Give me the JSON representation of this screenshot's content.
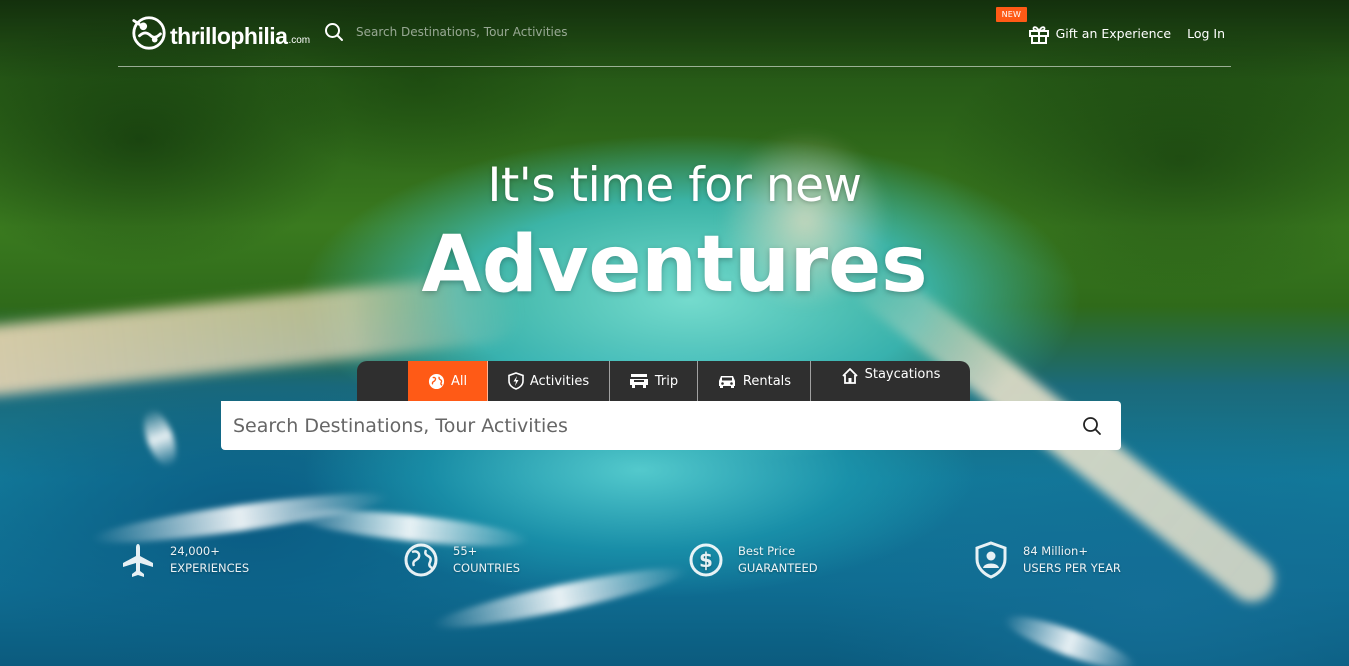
{
  "header": {
    "brand": "thrillophilia",
    "brand_suffix": ".com",
    "search_placeholder": "Search Destinations, Tour Activities",
    "new_badge": "NEW",
    "gift_label": "Gift an Experience",
    "login_label": "Log In"
  },
  "hero": {
    "line1": "It's time for new",
    "line2": "Adventures"
  },
  "tabs": [
    {
      "label": "All",
      "icon": "globe-icon",
      "active": true
    },
    {
      "label": "Activities",
      "icon": "bolt-shield-icon",
      "active": false
    },
    {
      "label": "Trip",
      "icon": "car-front-icon",
      "active": false
    },
    {
      "label": "Rentals",
      "icon": "car-icon",
      "active": false
    },
    {
      "label": "Staycations",
      "icon": "home-icon",
      "active": false
    }
  ],
  "search": {
    "placeholder": "Search Destinations, Tour Activities"
  },
  "stats": [
    {
      "value": "24,000+",
      "label": "EXPERIENCES",
      "icon": "airplane-icon"
    },
    {
      "value": "55+",
      "label": "COUNTRIES",
      "icon": "globe-icon"
    },
    {
      "value": "Best Price",
      "label": "GUARANTEED",
      "icon": "dollar-icon"
    },
    {
      "value": "84 Million+",
      "label": "USERS PER YEAR",
      "icon": "user-shield-icon"
    }
  ],
  "colors": {
    "accent": "#ff5a16",
    "tab_bar": "#2f2f2f",
    "text": "#ffffff"
  }
}
